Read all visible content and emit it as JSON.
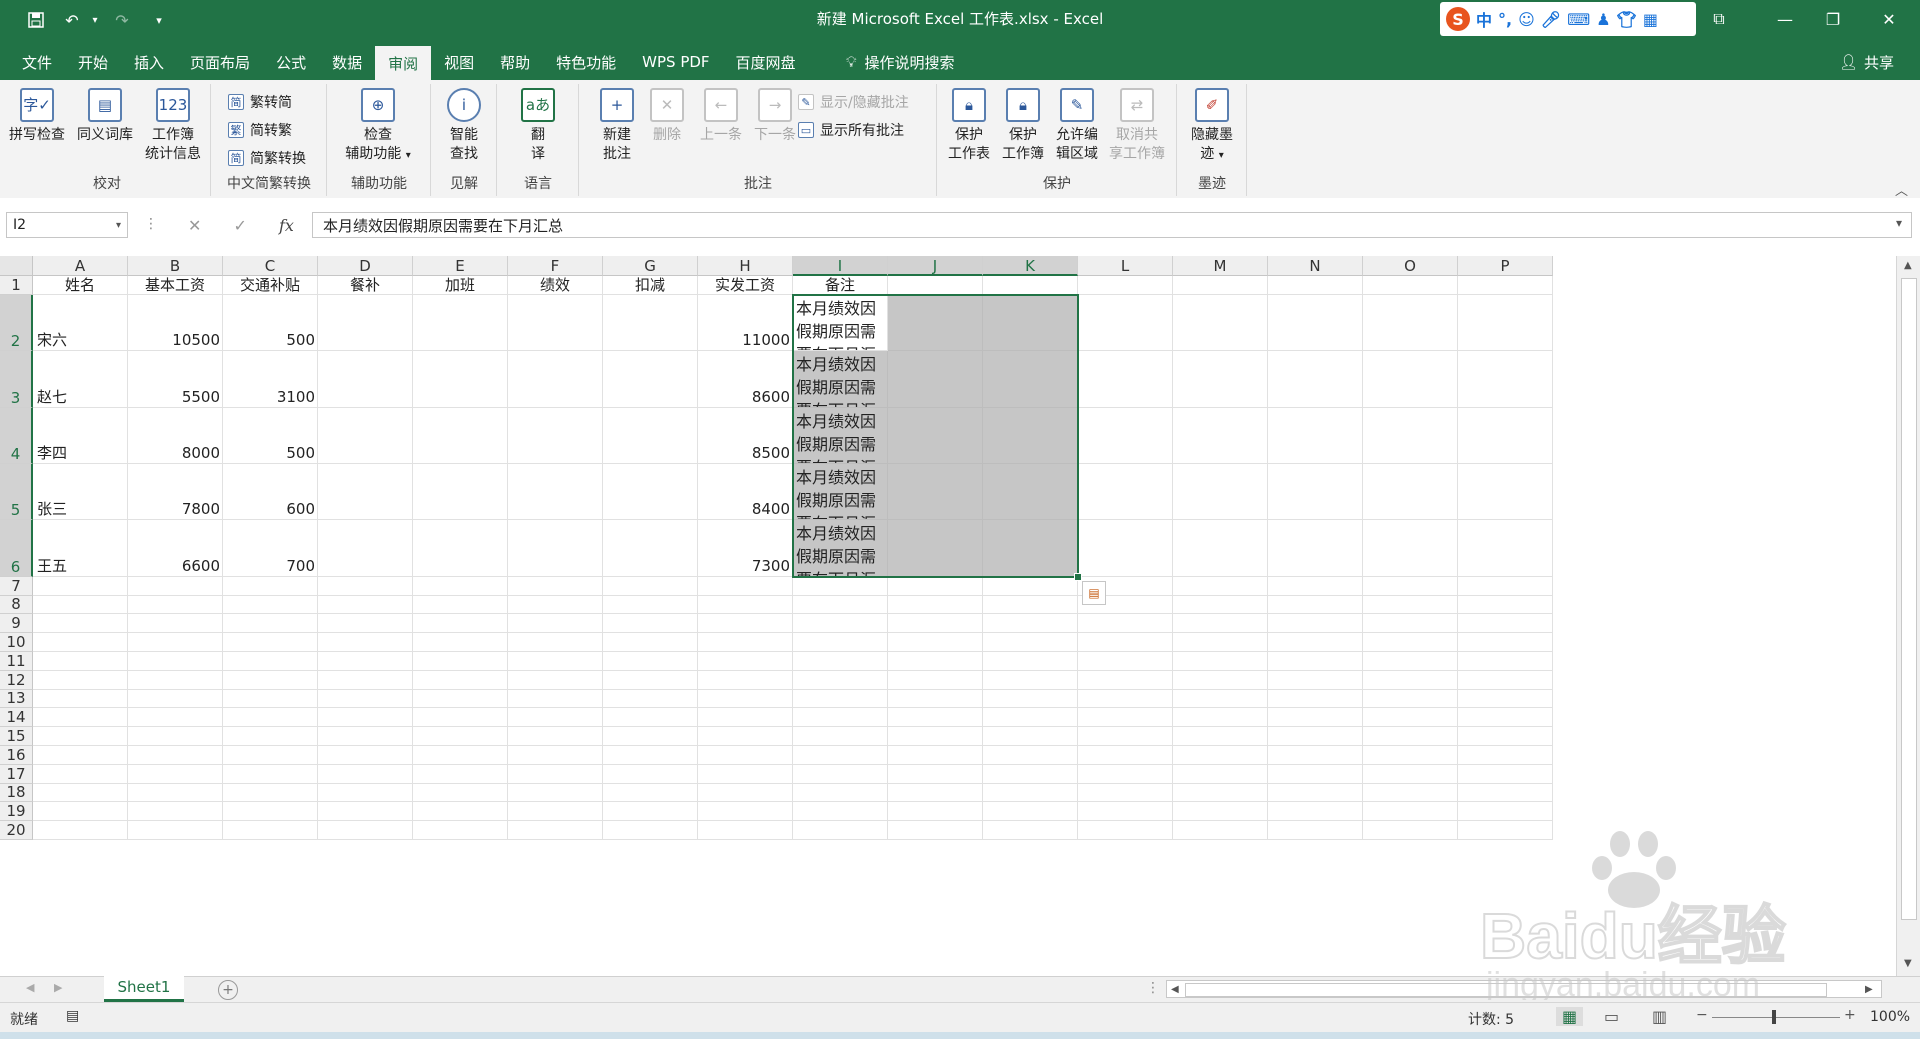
{
  "window": {
    "title": "新建 Microsoft Excel 工作表.xlsx  -  Excel"
  },
  "quick_access": [
    "save-icon",
    "undo-icon",
    "redo-icon",
    "customize-icon"
  ],
  "ime": {
    "label": "中"
  },
  "tabs": [
    "文件",
    "开始",
    "插入",
    "页面布局",
    "公式",
    "数据",
    "审阅",
    "视图",
    "帮助",
    "特色功能",
    "WPS PDF",
    "百度网盘"
  ],
  "tell_me": "操作说明搜索",
  "share": "共享",
  "ribbon": {
    "groups": {
      "proofing": "校对",
      "chinese_conv": "中文简繁转换",
      "accessibility": "辅助功能",
      "insights": "见解",
      "language": "语言",
      "comments": "批注",
      "protect": "保护",
      "ink": "墨迹"
    },
    "buttons": {
      "spelling": "拼写检查",
      "thesaurus": "同义词库",
      "workbook_stats_1": "工作簿",
      "workbook_stats_2": "统计信息",
      "trad_to_simp": "繁转简",
      "simp_to_trad": "简转繁",
      "conv": "简繁转换",
      "check_1": "检查",
      "check_2": "辅助功能",
      "smart_1": "智能",
      "smart_2": "查找",
      "translate_1": "翻",
      "translate_2": "译",
      "new_comment_1": "新建",
      "new_comment_2": "批注",
      "delete": "删除",
      "prev": "上一条",
      "next": "下一条",
      "show_hide": "显示/隐藏批注",
      "show_all": "显示所有批注",
      "protect_sheet_1": "保护",
      "protect_sheet_2": "工作表",
      "protect_wb_1": "保护",
      "protect_wb_2": "工作簿",
      "allow_edit_1": "允许编",
      "allow_edit_2": "辑区域",
      "unshare_1": "取消共",
      "unshare_2": "享工作簿",
      "hide_ink_1": "隐藏墨",
      "hide_ink_2": "迹"
    }
  },
  "formula_bar": {
    "name_box": "I2",
    "fx": "fx",
    "content": "本月绩效因假期原因需要在下月汇总"
  },
  "columns": [
    "A",
    "B",
    "C",
    "D",
    "E",
    "F",
    "G",
    "H",
    "I",
    "J",
    "K",
    "L",
    "M",
    "N",
    "O",
    "P"
  ],
  "rows": [
    "1",
    "2",
    "3",
    "4",
    "5",
    "6",
    "7",
    "8",
    "9",
    "10",
    "11",
    "12",
    "13",
    "14",
    "15",
    "16",
    "17",
    "18",
    "19",
    "20"
  ],
  "headers": [
    "姓名",
    "基本工资",
    "交通补贴",
    "餐补",
    "加班",
    "绩效",
    "扣减",
    "实发工资",
    "备注"
  ],
  "data_rows": [
    {
      "name": "宋六",
      "base": "10500",
      "transport": "500",
      "net": "11000",
      "note": "本月绩效因假期原因需要在下月汇总"
    },
    {
      "name": "赵七",
      "base": "5500",
      "transport": "3100",
      "net": "8600",
      "note": "本月绩效因假期原因需要在下月汇总"
    },
    {
      "name": "李四",
      "base": "8000",
      "transport": "500",
      "net": "8500",
      "note": "本月绩效因假期原因需要在下月汇总"
    },
    {
      "name": "张三",
      "base": "7800",
      "transport": "600",
      "net": "8400",
      "note": "本月绩效因假期原因需要在下月汇总"
    },
    {
      "name": "王五",
      "base": "6600",
      "transport": "700",
      "net": "7300",
      "note": "本月绩效因假期原因需要在下月汇总"
    }
  ],
  "sheet": {
    "name": "Sheet1"
  },
  "status": {
    "ready": "就绪",
    "count": "计数: 5",
    "zoom": "100%"
  },
  "watermark": {
    "text1": "Baidu经验",
    "text2": "jingyan.baidu.com"
  },
  "colors": {
    "accent": "#217346",
    "selection": "#c6c6c6"
  }
}
